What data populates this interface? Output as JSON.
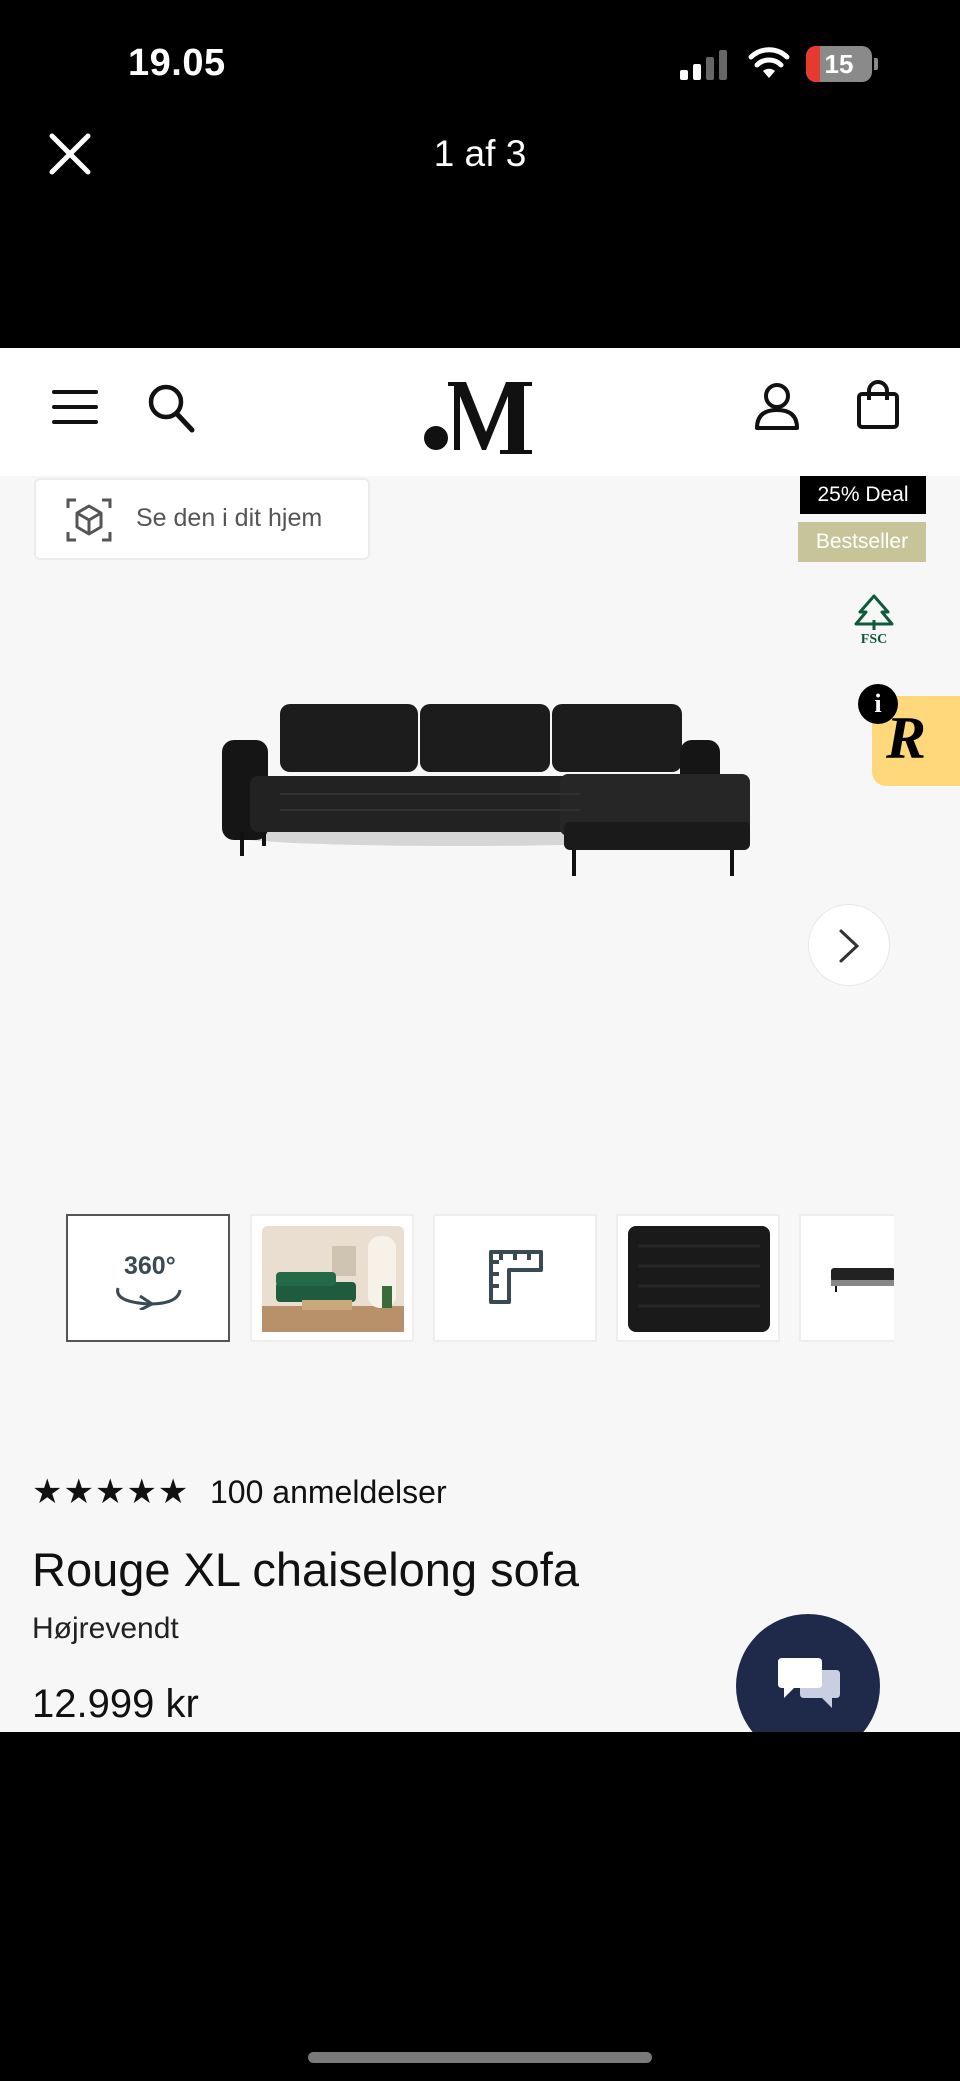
{
  "status_bar": {
    "time": "19.05",
    "battery": "15"
  },
  "viewer": {
    "counter": "1 af 3"
  },
  "site": {
    "logo": ".M"
  },
  "ar_button": {
    "label": "Se den i dit hjem"
  },
  "badges": {
    "deal": "25% Deal",
    "bestseller": "Bestseller",
    "fsc": "FSC"
  },
  "thumbnails": {
    "t1_label": "360°"
  },
  "product": {
    "stars": "★★★★★",
    "reviews": "100 anmeldelser",
    "title": "Rouge XL chaiselong sofa",
    "variant": "Højrevendt",
    "price": "12.999 kr"
  },
  "colors": {
    "accent_yellow": "#ffd87c",
    "bestseller_bg": "#c8c49a",
    "chat_bg": "#1f2a4a",
    "battery_low": "#e8392f"
  }
}
